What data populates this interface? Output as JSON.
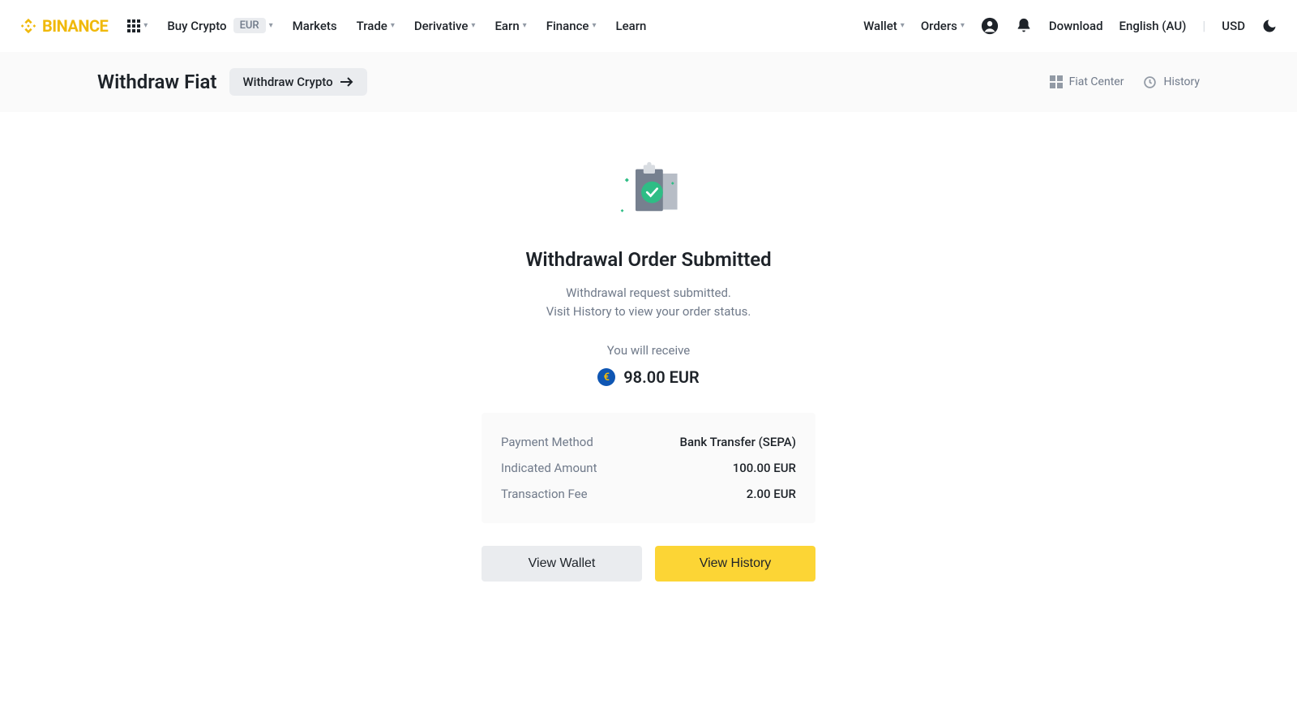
{
  "header": {
    "brand": "BINANCE",
    "apps_chevron": "▾",
    "nav": {
      "buy_crypto": "Buy Crypto",
      "buy_currency": "EUR",
      "markets": "Markets",
      "trade": "Trade",
      "derivative": "Derivative",
      "earn": "Earn",
      "finance": "Finance",
      "learn": "Learn"
    },
    "nav_right": {
      "wallet": "Wallet",
      "orders": "Orders",
      "download": "Download",
      "language": "English (AU)",
      "fiat": "USD"
    }
  },
  "pagebar": {
    "title": "Withdraw Fiat",
    "crypto_link": "Withdraw Crypto",
    "fiat_center": "Fiat Center",
    "history": "History"
  },
  "content": {
    "title": "Withdrawal Order Submitted",
    "line1": "Withdrawal request submitted.",
    "line2": "Visit History to view your order status.",
    "receive_label": "You will receive",
    "euro_sym": "€",
    "receive_amount": "98.00 EUR",
    "details": [
      {
        "label": "Payment Method",
        "value": "Bank Transfer (SEPA)"
      },
      {
        "label": "Indicated Amount",
        "value": "100.00 EUR"
      },
      {
        "label": "Transaction Fee",
        "value": "2.00 EUR"
      }
    ],
    "btn_wallet": "View Wallet",
    "btn_history": "View History"
  }
}
